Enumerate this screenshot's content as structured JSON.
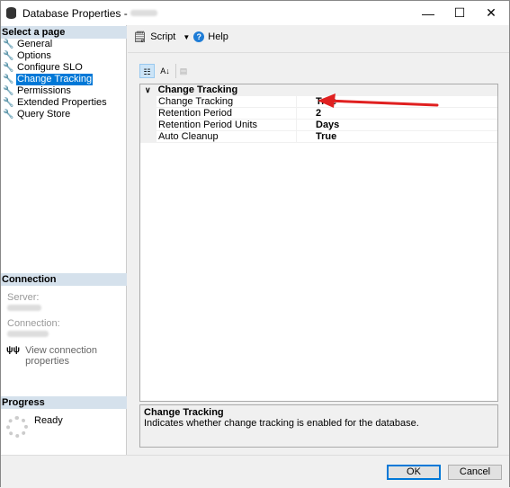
{
  "window": {
    "title": "Database Properties - ",
    "minimize": "—",
    "maximize": "☐",
    "close": "✕"
  },
  "left": {
    "select_header": "Select a page",
    "pages": [
      {
        "label": "General"
      },
      {
        "label": "Options"
      },
      {
        "label": "Configure SLO"
      },
      {
        "label": "Change Tracking",
        "selected": true
      },
      {
        "label": "Permissions"
      },
      {
        "label": "Extended Properties"
      },
      {
        "label": "Query Store"
      }
    ],
    "connection_header": "Connection",
    "server_label": "Server:",
    "connection_label": "Connection:",
    "view_conn_props": "View connection properties",
    "progress_header": "Progress",
    "progress_status": "Ready"
  },
  "toolbar": {
    "script": "Script",
    "help": "Help"
  },
  "grid": {
    "category": "Change Tracking",
    "rows": [
      {
        "name": "Change Tracking",
        "value": "True"
      },
      {
        "name": "Retention Period",
        "value": "2"
      },
      {
        "name": "Retention Period Units",
        "value": "Days"
      },
      {
        "name": "Auto Cleanup",
        "value": "True"
      }
    ]
  },
  "description": {
    "title": "Change Tracking",
    "text": "Indicates whether change tracking is enabled for the database."
  },
  "buttons": {
    "ok": "OK",
    "cancel": "Cancel"
  },
  "annotation_color": "#e02020"
}
